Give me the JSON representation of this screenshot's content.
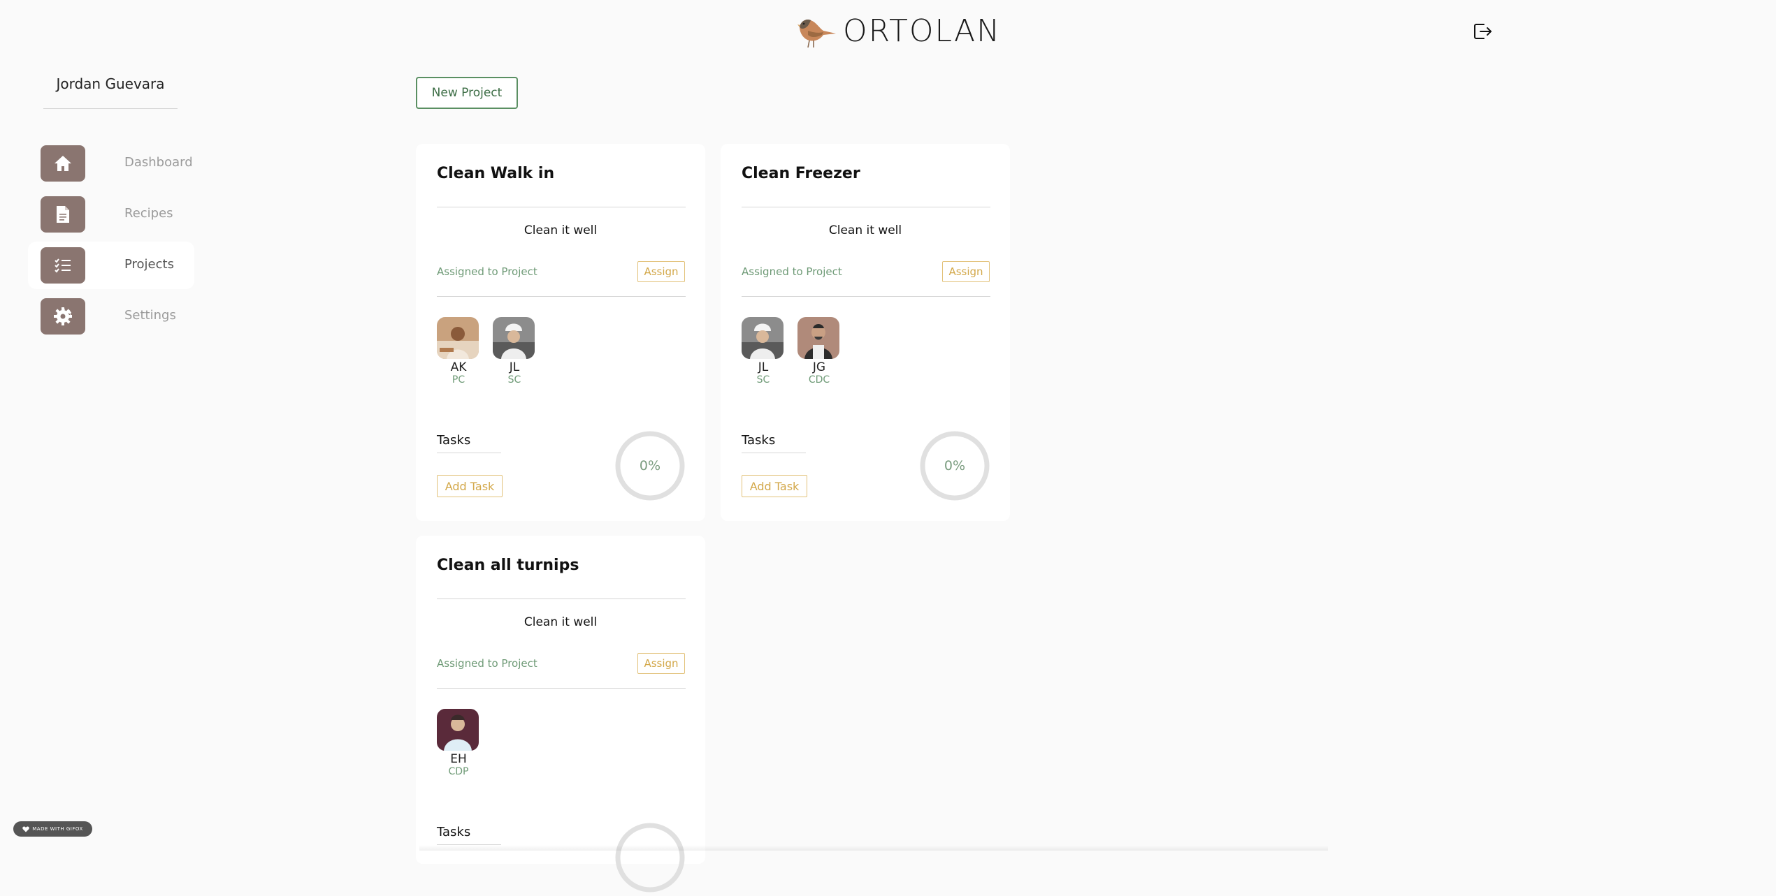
{
  "header": {
    "brand": "ORTOLAN"
  },
  "sidebar": {
    "user_name": "Jordan Guevara",
    "items": [
      {
        "label": "Dashboard",
        "icon": "home-icon"
      },
      {
        "label": "Recipes",
        "icon": "document-icon"
      },
      {
        "label": "Projects",
        "icon": "list-icon",
        "active": true
      },
      {
        "label": "Settings",
        "icon": "gear-icon"
      }
    ]
  },
  "main": {
    "new_project_label": "New Project",
    "projects": [
      {
        "title": "Clean Walk in",
        "description": "Clean it well",
        "assigned_label": "Assigned to Project",
        "assign_label": "Assign",
        "members": [
          {
            "initials": "AK",
            "role": "PC"
          },
          {
            "initials": "JL",
            "role": "SC"
          }
        ],
        "tasks_label": "Tasks",
        "add_task_label": "Add Task",
        "progress": "0%"
      },
      {
        "title": "Clean Freezer",
        "description": "Clean it well",
        "assigned_label": "Assigned to Project",
        "assign_label": "Assign",
        "members": [
          {
            "initials": "JL",
            "role": "SC"
          },
          {
            "initials": "JG",
            "role": "CDC"
          }
        ],
        "tasks_label": "Tasks",
        "add_task_label": "Add Task",
        "progress": "0%"
      },
      {
        "title": "Clean all turnips",
        "description": "Clean it well",
        "assigned_label": "Assigned to Project",
        "assign_label": "Assign",
        "members": [
          {
            "initials": "EH",
            "role": "CDP"
          }
        ],
        "tasks_label": "Tasks"
      }
    ]
  },
  "footer": {
    "made_with": "MADE WITH GIFOX"
  },
  "colors": {
    "nav_icon_bg": "#8a7570",
    "accent_green": "#5a8f62",
    "accent_gold": "#d3a84a"
  }
}
